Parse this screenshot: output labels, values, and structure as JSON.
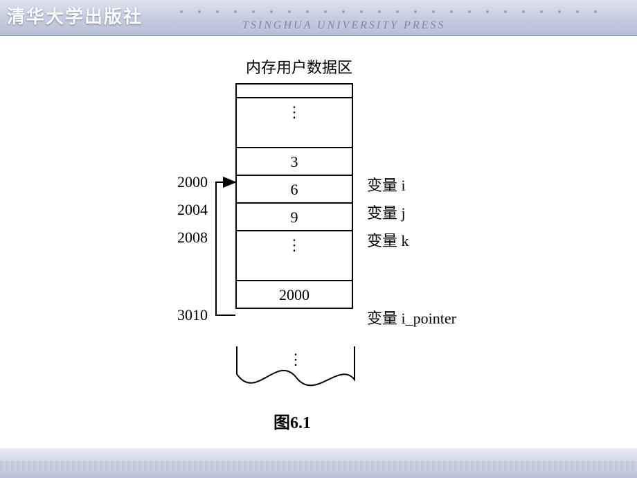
{
  "header": {
    "logo_text": "清华大学出版社",
    "subtitle": "TSINGHUA UNIVERSITY PRESS"
  },
  "diagram": {
    "title": "内存用户数据区",
    "cells": {
      "i_value": "3",
      "j_value": "6",
      "k_value": "9",
      "ipointer_value": "2000"
    },
    "addresses": {
      "i": "2000",
      "j": "2004",
      "k": "2008",
      "ipointer": "3010"
    },
    "labels": {
      "i": "变量 i",
      "j": "变量 j",
      "k": "变量 k",
      "ipointer": "变量 i_pointer"
    },
    "vdots": "⋮",
    "caption": "图6.1"
  }
}
